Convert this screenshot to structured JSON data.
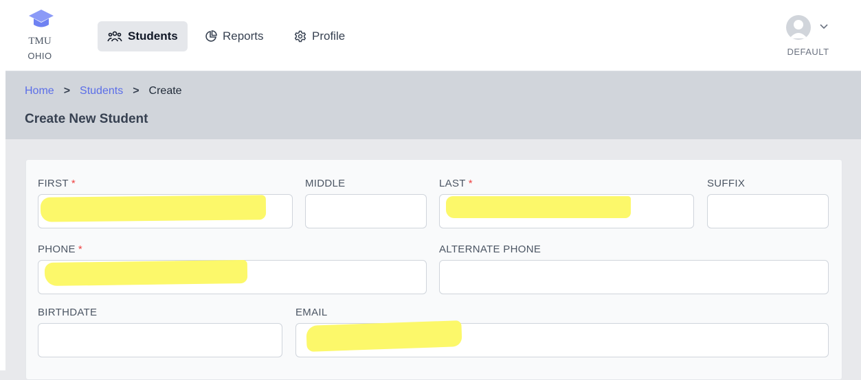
{
  "brand": {
    "line1": "TMU",
    "line2": "OHIO"
  },
  "nav": {
    "items": [
      {
        "label": "Students",
        "icon": "users-icon",
        "active": true
      },
      {
        "label": "Reports",
        "icon": "pie-chart-icon",
        "active": false
      },
      {
        "label": "Profile",
        "icon": "gear-icon",
        "active": false
      }
    ]
  },
  "user": {
    "name": "DEFAULT",
    "icon": "user-avatar-icon"
  },
  "breadcrumb": {
    "home": "Home",
    "students": "Students",
    "current": "Create",
    "separator": ">"
  },
  "page": {
    "title": "Create New Student"
  },
  "form": {
    "first": {
      "label": "FIRST",
      "required": "*",
      "value": ""
    },
    "middle": {
      "label": "MIDDLE",
      "value": ""
    },
    "last": {
      "label": "LAST",
      "required": "*",
      "value": ""
    },
    "suffix": {
      "label": "SUFFIX",
      "value": ""
    },
    "phone": {
      "label": "PHONE",
      "required": "*",
      "value": ""
    },
    "alt_phone": {
      "label": "ALTERNATE PHONE",
      "value": ""
    },
    "birthdate": {
      "label": "BIRTHDATE",
      "value": ""
    },
    "email": {
      "label": "EMAIL",
      "value": ""
    }
  },
  "colors": {
    "accent_link": "#5b6ee8",
    "required": "#ef4444",
    "logo": "#8b9af7",
    "redaction": "#fcf86a"
  }
}
